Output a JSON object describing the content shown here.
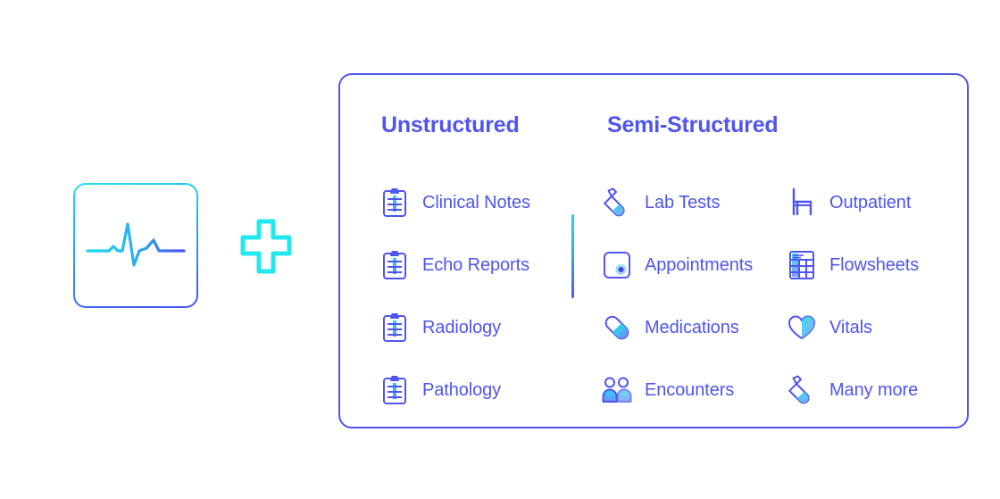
{
  "ecg_card": {
    "icon": "ecg-waveform-icon",
    "gradient_from": "#22E0EE",
    "gradient_to": "#4A50F0"
  },
  "plus": {
    "icon": "plus-icon",
    "color": "#22E8ED"
  },
  "panel": {
    "border_color": "#4F55EE",
    "accent_color": "#4F55EE",
    "icon_gradient_from": "#2BD9EC",
    "icon_gradient_to": "#4A50F0",
    "headings": [
      {
        "label": "Unstructured"
      },
      {
        "label": "Semi-Structured"
      }
    ],
    "divider": {
      "gradient_from": "#1FD8EC",
      "gradient_to": "#5552F5"
    },
    "columns": [
      {
        "name": "unstructured",
        "items": [
          {
            "label": "Clinical Notes",
            "icon": "clipboard-icon"
          },
          {
            "label": "Echo Reports",
            "icon": "clipboard-icon"
          },
          {
            "label": "Radiology",
            "icon": "clipboard-icon"
          },
          {
            "label": "Pathology",
            "icon": "clipboard-icon"
          }
        ]
      },
      {
        "name": "semi-structured-left",
        "items": [
          {
            "label": "Lab Tests",
            "icon": "test-tube-icon"
          },
          {
            "label": "Appointments",
            "icon": "calendar-dot-icon"
          },
          {
            "label": "Medications",
            "icon": "pill-capsule-icon"
          },
          {
            "label": "Encounters",
            "icon": "people-icon"
          }
        ]
      },
      {
        "name": "semi-structured-right",
        "items": [
          {
            "label": "Outpatient",
            "icon": "chair-icon"
          },
          {
            "label": "Flowsheets",
            "icon": "table-grid-icon"
          },
          {
            "label": "Vitals",
            "icon": "heart-icon"
          },
          {
            "label": "Many more",
            "icon": "test-tube-icon"
          }
        ]
      }
    ]
  }
}
